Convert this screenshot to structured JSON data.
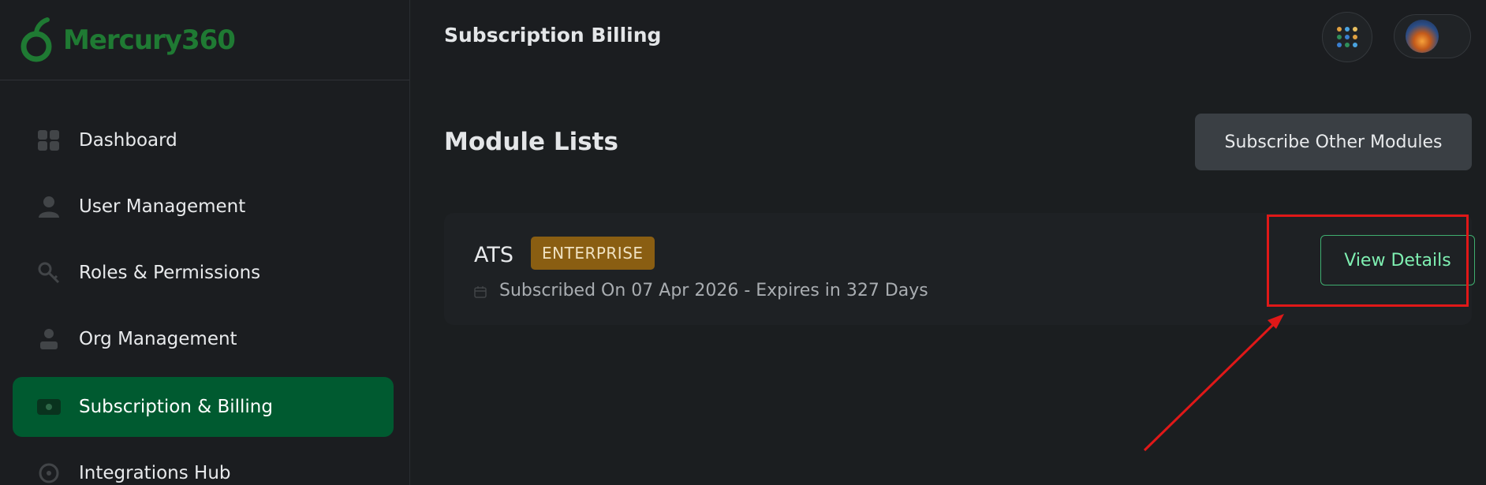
{
  "brand": {
    "name": "Mercury360",
    "color": "#1f7a33"
  },
  "header": {
    "title": "Subscription Billing"
  },
  "sidebar": {
    "items": [
      {
        "label": "Dashboard",
        "icon": "dashboard-icon",
        "active": false
      },
      {
        "label": "User Management",
        "icon": "user-icon",
        "active": false
      },
      {
        "label": "Roles & Permissions",
        "icon": "key-icon",
        "active": false
      },
      {
        "label": "Org Management",
        "icon": "org-icon",
        "active": false
      },
      {
        "label": "Subscription & Billing",
        "icon": "billing-icon",
        "active": true
      },
      {
        "label": "Integrations Hub",
        "icon": "integrations-icon",
        "active": false
      }
    ]
  },
  "main": {
    "section_title": "Module Lists",
    "subscribe_label": "Subscribe Other Modules",
    "modules": [
      {
        "name": "ATS",
        "tier": "ENTERPRISE",
        "meta": "Subscribed On 07 Apr 2026 - Expires in 327 Days",
        "action_label": "View Details"
      }
    ]
  },
  "colors": {
    "accent": "#005a30",
    "badge": "#8a5e12",
    "annotation": "#e01818",
    "view_button_text": "#7ff0b2"
  }
}
